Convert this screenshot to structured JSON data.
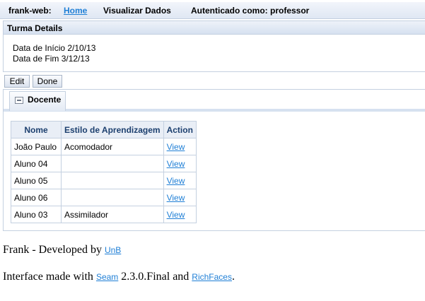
{
  "toolbar": {
    "app_name": "frank-web:",
    "home": "Home",
    "visualizar": "Visualizar Dados",
    "auth": "Autenticado como: professor"
  },
  "details": {
    "title": "Turma Details",
    "start": "Data de Início 2/10/13",
    "end": "Data de Fim 3/12/13"
  },
  "buttons": {
    "edit": "Edit",
    "done": "Done"
  },
  "tab": {
    "label": "Docente"
  },
  "table": {
    "headers": [
      "Nome",
      "Estilo de Aprendizagem",
      "Action"
    ],
    "rows": [
      {
        "nome": "João Paulo",
        "estilo": "Acomodador",
        "action": "View"
      },
      {
        "nome": "Aluno 04",
        "estilo": "",
        "action": "View"
      },
      {
        "nome": "Aluno 05",
        "estilo": "",
        "action": "View"
      },
      {
        "nome": "Aluno 06",
        "estilo": "",
        "action": "View"
      },
      {
        "nome": "Aluno 03",
        "estilo": "Assimilador",
        "action": "View"
      }
    ]
  },
  "footer": {
    "line1_text": "Frank - Developed by",
    "line1_link": "UnB",
    "line2_text_a": "Interface made with",
    "line2_link_a": "Seam",
    "line2_text_b": "2.3.0.Final and",
    "line2_link_b": "RichFaces",
    "line2_end": "."
  }
}
